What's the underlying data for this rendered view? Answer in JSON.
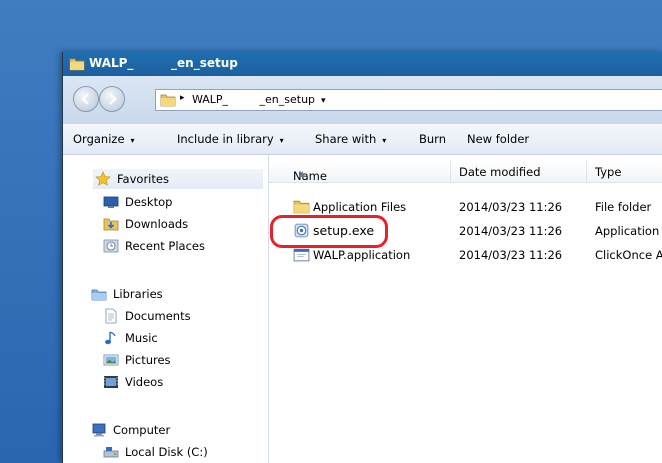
{
  "window": {
    "title": "WALP_         _en_setup"
  },
  "address": {
    "separator": "▸",
    "path": "WALP_         _en_setup",
    "dropdown": "▾"
  },
  "toolbar": {
    "organize": "Organize",
    "include_in_library": "Include in library",
    "share_with": "Share with",
    "burn": "Burn",
    "new_folder": "New folder",
    "caret": "▾"
  },
  "nav": {
    "favorites": "Favorites",
    "desktop": "Desktop",
    "downloads": "Downloads",
    "recent_places": "Recent Places",
    "libraries": "Libraries",
    "documents": "Documents",
    "music": "Music",
    "pictures": "Pictures",
    "videos": "Videos",
    "computer": "Computer",
    "local_disk": "Local Disk (C:)"
  },
  "columns": {
    "name": "Name",
    "sort_indicator": "▲",
    "date_modified": "Date modified",
    "type": "Type"
  },
  "files": [
    {
      "name": "Application Files",
      "date": "2014/03/23 11:26",
      "type": "File folder",
      "icon": "folder-icon"
    },
    {
      "name": "setup.exe",
      "date": "2014/03/23 11:26",
      "type": "Application",
      "icon": "setup-exe-icon"
    },
    {
      "name": "WALP.application",
      "date": "2014/03/23 11:26",
      "type": "ClickOnce A",
      "icon": "application-manifest-icon"
    }
  ],
  "colors": {
    "desktop": "#2a66b0",
    "titlebar": "#1d5fa0",
    "highlight": "#e8202a"
  }
}
